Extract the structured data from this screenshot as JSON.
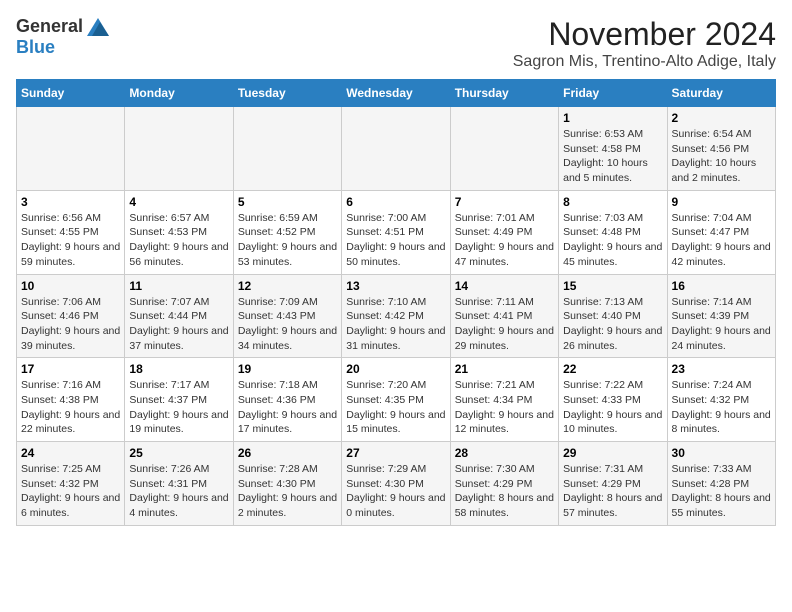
{
  "logo": {
    "general": "General",
    "blue": "Blue"
  },
  "title": {
    "month_year": "November 2024",
    "location": "Sagron Mis, Trentino-Alto Adige, Italy"
  },
  "header": {
    "days": [
      "Sunday",
      "Monday",
      "Tuesday",
      "Wednesday",
      "Thursday",
      "Friday",
      "Saturday"
    ]
  },
  "weeks": [
    {
      "cells": [
        {
          "day": "",
          "info": ""
        },
        {
          "day": "",
          "info": ""
        },
        {
          "day": "",
          "info": ""
        },
        {
          "day": "",
          "info": ""
        },
        {
          "day": "",
          "info": ""
        },
        {
          "day": "1",
          "info": "Sunrise: 6:53 AM\nSunset: 4:58 PM\nDaylight: 10 hours and 5 minutes."
        },
        {
          "day": "2",
          "info": "Sunrise: 6:54 AM\nSunset: 4:56 PM\nDaylight: 10 hours and 2 minutes."
        }
      ]
    },
    {
      "cells": [
        {
          "day": "3",
          "info": "Sunrise: 6:56 AM\nSunset: 4:55 PM\nDaylight: 9 hours and 59 minutes."
        },
        {
          "day": "4",
          "info": "Sunrise: 6:57 AM\nSunset: 4:53 PM\nDaylight: 9 hours and 56 minutes."
        },
        {
          "day": "5",
          "info": "Sunrise: 6:59 AM\nSunset: 4:52 PM\nDaylight: 9 hours and 53 minutes."
        },
        {
          "day": "6",
          "info": "Sunrise: 7:00 AM\nSunset: 4:51 PM\nDaylight: 9 hours and 50 minutes."
        },
        {
          "day": "7",
          "info": "Sunrise: 7:01 AM\nSunset: 4:49 PM\nDaylight: 9 hours and 47 minutes."
        },
        {
          "day": "8",
          "info": "Sunrise: 7:03 AM\nSunset: 4:48 PM\nDaylight: 9 hours and 45 minutes."
        },
        {
          "day": "9",
          "info": "Sunrise: 7:04 AM\nSunset: 4:47 PM\nDaylight: 9 hours and 42 minutes."
        }
      ]
    },
    {
      "cells": [
        {
          "day": "10",
          "info": "Sunrise: 7:06 AM\nSunset: 4:46 PM\nDaylight: 9 hours and 39 minutes."
        },
        {
          "day": "11",
          "info": "Sunrise: 7:07 AM\nSunset: 4:44 PM\nDaylight: 9 hours and 37 minutes."
        },
        {
          "day": "12",
          "info": "Sunrise: 7:09 AM\nSunset: 4:43 PM\nDaylight: 9 hours and 34 minutes."
        },
        {
          "day": "13",
          "info": "Sunrise: 7:10 AM\nSunset: 4:42 PM\nDaylight: 9 hours and 31 minutes."
        },
        {
          "day": "14",
          "info": "Sunrise: 7:11 AM\nSunset: 4:41 PM\nDaylight: 9 hours and 29 minutes."
        },
        {
          "day": "15",
          "info": "Sunrise: 7:13 AM\nSunset: 4:40 PM\nDaylight: 9 hours and 26 minutes."
        },
        {
          "day": "16",
          "info": "Sunrise: 7:14 AM\nSunset: 4:39 PM\nDaylight: 9 hours and 24 minutes."
        }
      ]
    },
    {
      "cells": [
        {
          "day": "17",
          "info": "Sunrise: 7:16 AM\nSunset: 4:38 PM\nDaylight: 9 hours and 22 minutes."
        },
        {
          "day": "18",
          "info": "Sunrise: 7:17 AM\nSunset: 4:37 PM\nDaylight: 9 hours and 19 minutes."
        },
        {
          "day": "19",
          "info": "Sunrise: 7:18 AM\nSunset: 4:36 PM\nDaylight: 9 hours and 17 minutes."
        },
        {
          "day": "20",
          "info": "Sunrise: 7:20 AM\nSunset: 4:35 PM\nDaylight: 9 hours and 15 minutes."
        },
        {
          "day": "21",
          "info": "Sunrise: 7:21 AM\nSunset: 4:34 PM\nDaylight: 9 hours and 12 minutes."
        },
        {
          "day": "22",
          "info": "Sunrise: 7:22 AM\nSunset: 4:33 PM\nDaylight: 9 hours and 10 minutes."
        },
        {
          "day": "23",
          "info": "Sunrise: 7:24 AM\nSunset: 4:32 PM\nDaylight: 9 hours and 8 minutes."
        }
      ]
    },
    {
      "cells": [
        {
          "day": "24",
          "info": "Sunrise: 7:25 AM\nSunset: 4:32 PM\nDaylight: 9 hours and 6 minutes."
        },
        {
          "day": "25",
          "info": "Sunrise: 7:26 AM\nSunset: 4:31 PM\nDaylight: 9 hours and 4 minutes."
        },
        {
          "day": "26",
          "info": "Sunrise: 7:28 AM\nSunset: 4:30 PM\nDaylight: 9 hours and 2 minutes."
        },
        {
          "day": "27",
          "info": "Sunrise: 7:29 AM\nSunset: 4:30 PM\nDaylight: 9 hours and 0 minutes."
        },
        {
          "day": "28",
          "info": "Sunrise: 7:30 AM\nSunset: 4:29 PM\nDaylight: 8 hours and 58 minutes."
        },
        {
          "day": "29",
          "info": "Sunrise: 7:31 AM\nSunset: 4:29 PM\nDaylight: 8 hours and 57 minutes."
        },
        {
          "day": "30",
          "info": "Sunrise: 7:33 AM\nSunset: 4:28 PM\nDaylight: 8 hours and 55 minutes."
        }
      ]
    }
  ]
}
